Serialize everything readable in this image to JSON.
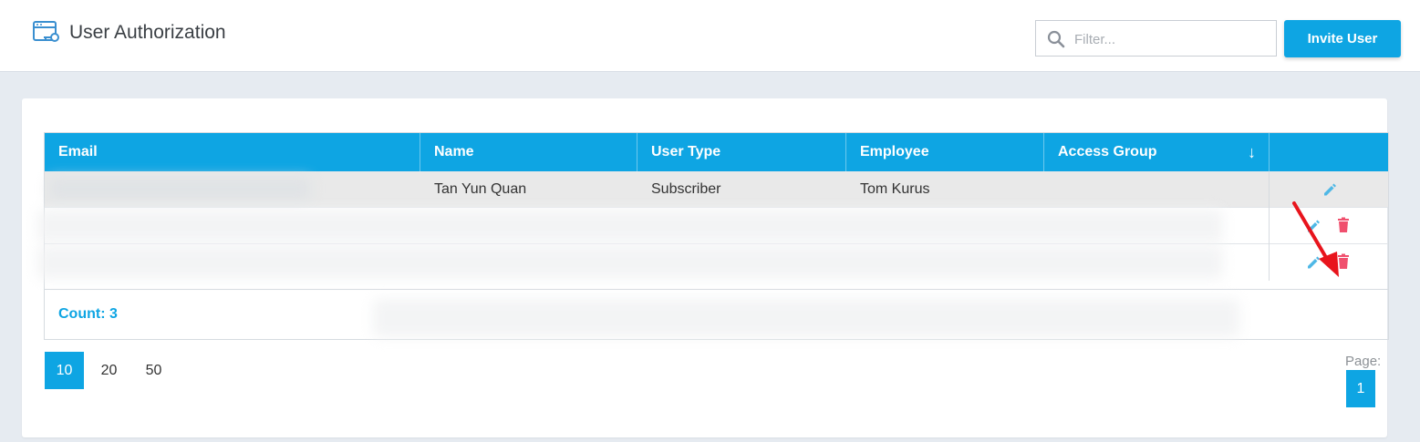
{
  "header": {
    "title": "User Authorization",
    "filter_placeholder": "Filter...",
    "invite_label": "Invite User",
    "app_icon": "user-key-icon"
  },
  "table": {
    "columns": [
      "Email",
      "Name",
      "User Type",
      "Employee",
      "Access Group"
    ],
    "sort_indicator": "↓",
    "rows": [
      {
        "email": "",
        "name": "Tan Yun Quan",
        "user_type": "Subscriber",
        "employee": "Tom Kurus",
        "access_group": ""
      }
    ],
    "count_label": "Count: 3"
  },
  "pagination": {
    "sizes": [
      "10",
      "20",
      "50"
    ],
    "active_size": "10",
    "page_label": "Page:",
    "current_page": "1"
  },
  "colors": {
    "accent": "#0ea5e3",
    "edit_icon": "#4fb8e6",
    "delete_icon": "#f0506e",
    "annotation_arrow": "#e8141c"
  }
}
